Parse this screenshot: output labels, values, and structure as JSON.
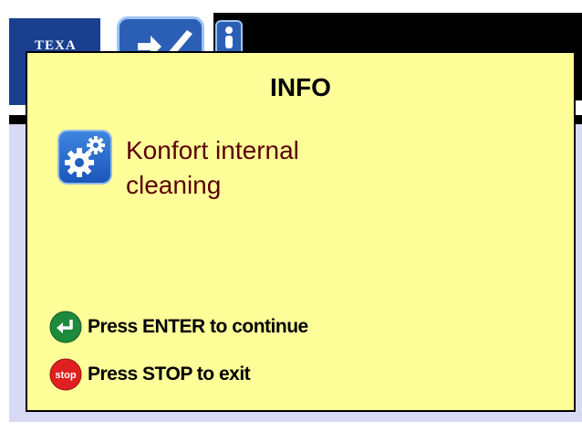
{
  "header": {
    "logo_text": "TEXA"
  },
  "dialog": {
    "title": "INFO",
    "message_line1": "Konfort internal",
    "message_line2": "cleaning",
    "enter_hint": "Press ENTER to continue",
    "stop_hint": "Press STOP to exit",
    "stop_icon_label": "stop"
  },
  "colors": {
    "dialog_bg": "#ffff99",
    "message_text": "#5a0000",
    "enter_icon": "#1e8a3c",
    "stop_icon": "#e02020",
    "logo_bg": "#1b3f8f"
  },
  "icons": {
    "enter": "enter-arrow-icon",
    "stop": "stop-sign-icon",
    "process": "gears-icon"
  }
}
